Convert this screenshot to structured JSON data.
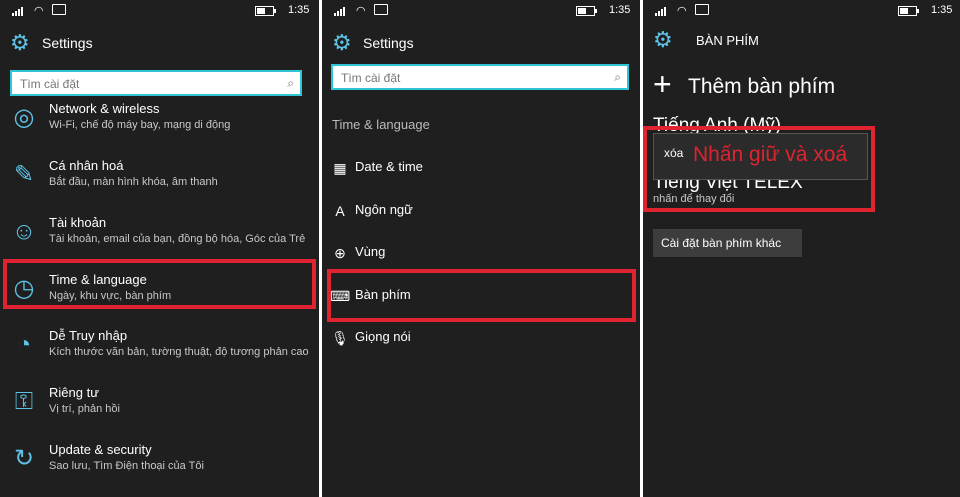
{
  "status": {
    "time": "1:35"
  },
  "panel1": {
    "title": "Settings",
    "search_placeholder": "Tìm cài đặt",
    "items": [
      {
        "title": "Network & wireless",
        "subtitle": "Wi-Fi, chế độ máy bay, mạng di động",
        "icon": "globe-icon"
      },
      {
        "title": "Cá nhân hoá",
        "subtitle": "Bắt đầu, màn hình khóa, âm thanh",
        "icon": "paint-icon"
      },
      {
        "title": "Tài khoản",
        "subtitle": "Tài khoản, email của bạn, đồng bộ hóa, Góc của Trẻ",
        "icon": "person-icon"
      },
      {
        "title": "Time & language",
        "subtitle": "Ngày, khu vực, bàn phím",
        "icon": "time-language-icon"
      },
      {
        "title": "Dễ Truy nhập",
        "subtitle": "Kích thước văn bản, tường thuật, độ tương phản cao",
        "icon": "ease-of-access-icon"
      },
      {
        "title": "Riêng tư",
        "subtitle": "Vị trí, phản hồi",
        "icon": "lock-icon"
      },
      {
        "title": "Update & security",
        "subtitle": "Sao lưu, Tìm Điện thoại của Tôi",
        "icon": "refresh-icon"
      }
    ]
  },
  "panel2": {
    "title": "Settings",
    "search_placeholder": "Tìm cài đặt",
    "section": "Time & language",
    "items": [
      {
        "label": "Date & time",
        "icon": "calendar-icon"
      },
      {
        "label": "Ngôn ngữ",
        "icon": "language-icon"
      },
      {
        "label": "Vùng",
        "icon": "globe-icon"
      },
      {
        "label": "Bàn phím",
        "icon": "keyboard-icon"
      },
      {
        "label": "Giọng nói",
        "icon": "microphone-icon"
      }
    ]
  },
  "panel3": {
    "title": "BÀN PHÍM",
    "add_label": "Thêm bàn phím",
    "keyboard1": "Tiếng Anh (Mỹ)",
    "keyboard2": "Tiếng Việt TELEX",
    "keyboard2_sub": "nhấn để thay đổi",
    "context_menu": "xóa",
    "annotation": "Nhấn giữ và xoá",
    "other_button": "Cài đặt bàn phím khác"
  },
  "colors": {
    "accent": "#5ec2e6",
    "highlight": "#e02330",
    "search_border": "#2ec6d6"
  }
}
